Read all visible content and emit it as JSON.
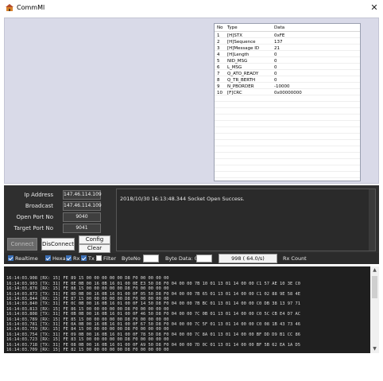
{
  "window": {
    "title": "CommMl",
    "close_label": "✕"
  },
  "grid": {
    "headers": {
      "no": "No",
      "type": "Type",
      "data": "Data"
    },
    "rows": [
      {
        "no": "1",
        "type": "[H]STX",
        "data": "0xFE"
      },
      {
        "no": "2",
        "type": "[H]Sequence",
        "data": "137"
      },
      {
        "no": "3",
        "type": "[H]Message ID",
        "data": "21"
      },
      {
        "no": "4",
        "type": "[H]Length",
        "data": "0"
      },
      {
        "no": "5",
        "type": "NID_MSG",
        "data": "0"
      },
      {
        "no": "6",
        "type": "L_MSG",
        "data": "0"
      },
      {
        "no": "7",
        "type": "Q_ATO_READY",
        "data": "0"
      },
      {
        "no": "8",
        "type": "Q_TR_BERTH",
        "data": "0"
      },
      {
        "no": "9",
        "type": "N_PBORDER",
        "data": "-10000"
      },
      {
        "no": "10",
        "type": "[F]CRC",
        "data": "0x00000000"
      }
    ]
  },
  "connection": {
    "ip_label": "Ip Address",
    "ip_value": "147.46.114.109",
    "broadcast_label": "Broadcast",
    "broadcast_value": "147.46.114.109",
    "open_port_label": "Open Port No",
    "open_port_value": "9040",
    "target_port_label": "Target Port No",
    "target_port_value": "9041",
    "connect_label": "Connect",
    "disconnect_label": "DisConnect",
    "config_label": "Config",
    "clear_label": "Clear"
  },
  "status_log": {
    "line": "2018/10/30  16:13:48.344  Socket Open Success."
  },
  "options": {
    "realtime": {
      "label": "Realtime",
      "checked": true
    },
    "hexa": {
      "label": "Hexa",
      "checked": true
    },
    "rx": {
      "label": "Rx",
      "checked": true
    },
    "tx": {
      "label": "Tx",
      "checked": true
    },
    "filter": {
      "label": "Filter",
      "checked": false
    },
    "byteno_label": "ByteNo",
    "bytedata_label": "Byte Data: 0x",
    "count_value": "998 ( 64.0/s)",
    "rx_count_label": "Rx Count"
  },
  "rx_log": [
    "16:14:03.908 [RX: 15] FE 89 15 00 00 00 00 00 D8 F0 00 00 00 00",
    "16:14:03.903 [TX: 31] FE 0E 0B 00 16 0B 16 01 00 0E E3 50 D8 F0 04 00 00 7B 10 01 13 01 14 00 00 C1 57 AE 10 3E C0",
    "16:14:03.878 [RX: 15] FE 88 15 00 00 00 00 00 D8 F0 00 00 00 00",
    "16:14:03.873 [TX: 31] FE 0D 0B 00 16 0B 16 01 00 0F 05 50 D8 F0 04 00 00 7B 65 01 13 01 14 00 00 C1 02 88 9E 58 4E",
    "16:14:03.844 [RX: 15] FE 87 15 00 00 00 00 00 D8 F0 00 00 00 00",
    "16:14:03.840 [TX: 31] FE 0C 0B 00 16 0B 16 01 00 0F 14 50 D8 F0 04 00 00 7B BC 01 13 01 14 00 00 C0 DB 38 13 97 71",
    "16:14:03.813 [RX: 15] FE 86 15 00 00 00 00 00 D8 F0 00 00 00 00",
    "16:14:03.808 [TX: 31] FE 0B 0B 00 16 0B 16 01 00 0F 46 50 D8 F0 04 00 00 7C 0B 01 13 01 14 00 00 C0 5C CB E4 D7 AC",
    "16:14:03.789 [RX: 15] FE 85 15 00 00 00 00 00 D8 F0 00 00 00 00",
    "16:14:03.781 [TX: 31] FE 0A 0B 00 16 0B 16 01 00 0F 67 50 D8 F0 04 00 00 7C 5F 01 13 01 14 00 00 C0 08 1B 43 73 46",
    "16:14:03.759 [RX: 15] FE 84 15 00 00 00 00 00 D8 F0 00 00 00 00",
    "16:14:03.754 [TX: 31] FE 09 0B 00 16 0B 16 01 00 0F 78 50 D8 F0 04 00 00 7C 8A 01 13 01 14 00 00 BF DD D9 B1 CC 86",
    "16:14:03.723 [RX: 15] FE 83 15 00 00 00 00 00 D8 F0 00 00 00 00",
    "16:14:03.718 [TX: 31] FE 08 0B 00 16 0B 16 01 00 0F A9 50 D8 F0 04 00 00 7D 0C 01 13 01 14 00 00 BF 5B 62 EA 1A D5",
    "16:14:03.709 [RX: 15] FE 82 15 00 00 00 00 00 D8 F0 00 00 00 00"
  ]
}
